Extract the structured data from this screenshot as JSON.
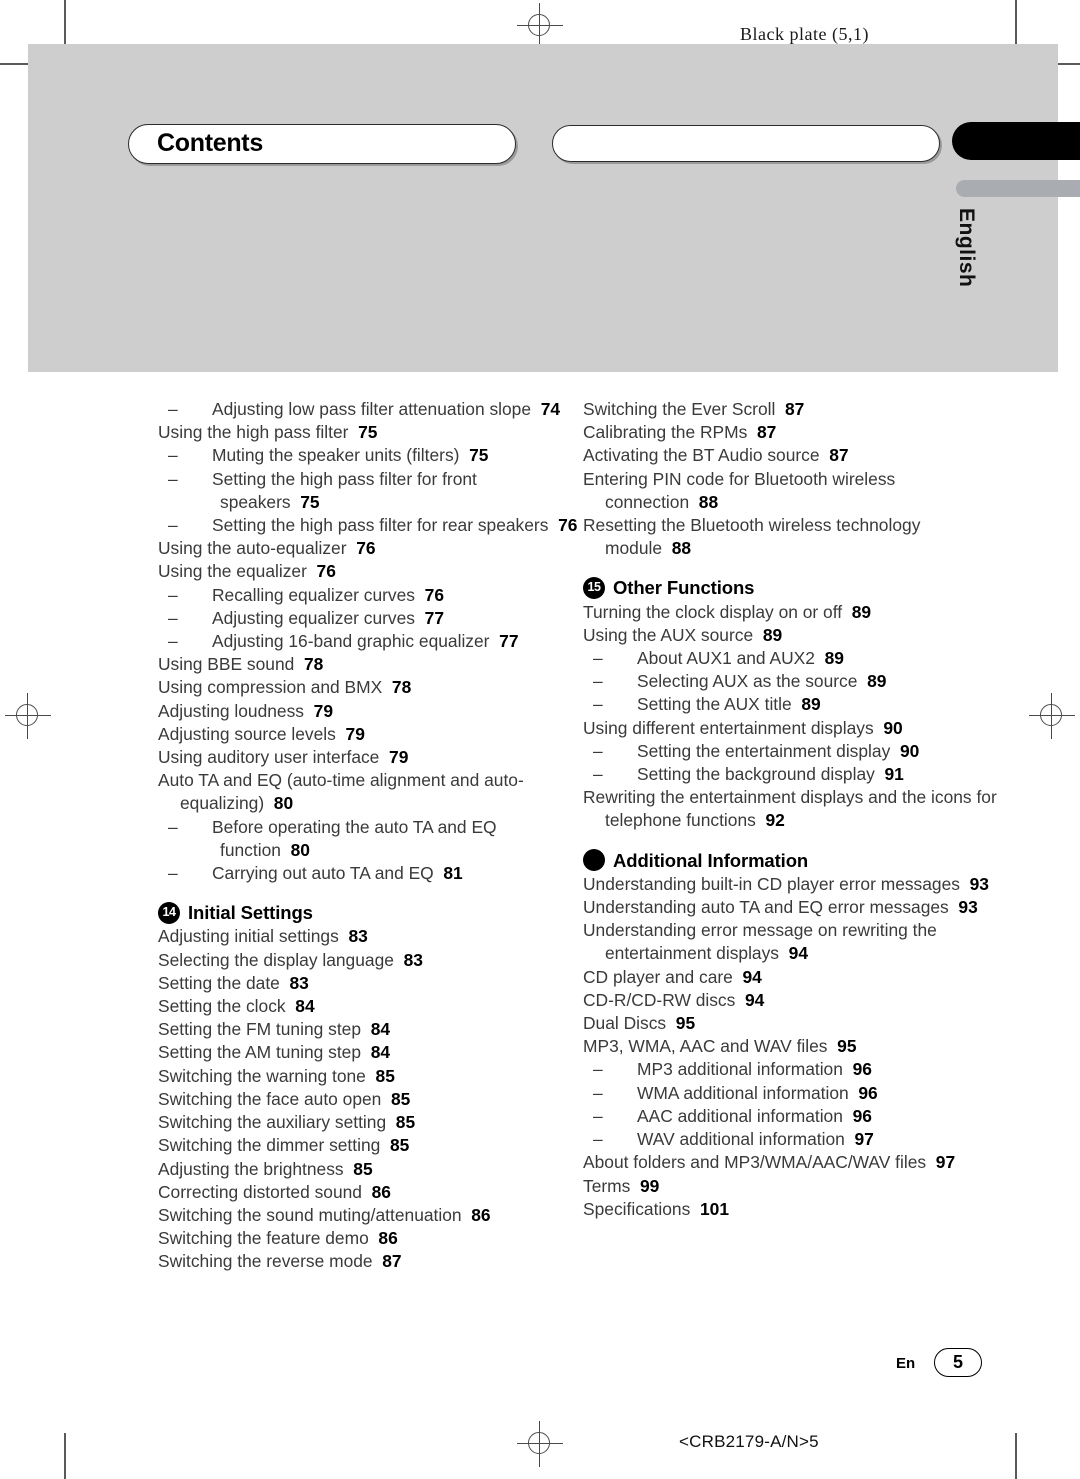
{
  "page": {
    "plate_label": "Black plate (5,1)",
    "doc_code": "<CRB2179-A/N>5",
    "footer_lang": "En",
    "page_number": "5",
    "language_tab": "English",
    "accent_black": "#000000",
    "band_gray": "#cecece",
    "tab_gray": "#a9acb0"
  },
  "header": {
    "title": "Contents",
    "second_bar": ""
  },
  "toc": {
    "left_column": [
      {
        "type": "sub",
        "text": "Adjusting low pass filter attenuation slope",
        "page": "74"
      },
      {
        "type": "entry",
        "text": "Using the high pass filter",
        "page": "75"
      },
      {
        "type": "sub",
        "text": "Muting the speaker units (filters)",
        "page": "75"
      },
      {
        "type": "sub",
        "text": "Setting the high pass filter for front speakers",
        "page": "75"
      },
      {
        "type": "sub",
        "text": "Setting the high pass filter for rear speakers",
        "page": "76"
      },
      {
        "type": "entry",
        "text": "Using the auto-equalizer",
        "page": "76"
      },
      {
        "type": "entry",
        "text": "Using the equalizer",
        "page": "76"
      },
      {
        "type": "sub",
        "text": "Recalling equalizer curves",
        "page": "76"
      },
      {
        "type": "sub",
        "text": "Adjusting equalizer curves",
        "page": "77"
      },
      {
        "type": "sub",
        "text": "Adjusting 16-band graphic equalizer",
        "page": "77"
      },
      {
        "type": "entry",
        "text": "Using BBE sound",
        "page": "78"
      },
      {
        "type": "entry",
        "text": "Using compression and BMX",
        "page": "78"
      },
      {
        "type": "entry",
        "text": "Adjusting loudness",
        "page": "79"
      },
      {
        "type": "entry",
        "text": "Adjusting source levels",
        "page": "79"
      },
      {
        "type": "entry",
        "text": "Using auditory user interface",
        "page": "79"
      },
      {
        "type": "entry",
        "text": "Auto TA and EQ (auto-time alignment and auto-equalizing)",
        "page": "80"
      },
      {
        "type": "sub",
        "text": "Before operating the auto TA and EQ function",
        "page": "80"
      },
      {
        "type": "sub",
        "text": "Carrying out auto TA and EQ",
        "page": "81"
      },
      {
        "type": "section",
        "badge": "14",
        "text": "Initial Settings"
      },
      {
        "type": "entry",
        "text": "Adjusting initial settings",
        "page": "83"
      },
      {
        "type": "entry",
        "text": "Selecting the display language",
        "page": "83"
      },
      {
        "type": "entry",
        "text": "Setting the date",
        "page": "83"
      },
      {
        "type": "entry",
        "text": "Setting the clock",
        "page": "84"
      },
      {
        "type": "entry",
        "text": "Setting the FM tuning step",
        "page": "84"
      },
      {
        "type": "entry",
        "text": "Setting the AM tuning step",
        "page": "84"
      },
      {
        "type": "entry",
        "text": "Switching the warning tone",
        "page": "85"
      },
      {
        "type": "entry",
        "text": "Switching the face auto open",
        "page": "85"
      },
      {
        "type": "entry",
        "text": "Switching the auxiliary setting",
        "page": "85"
      },
      {
        "type": "entry",
        "text": "Switching the dimmer setting",
        "page": "85"
      },
      {
        "type": "entry",
        "text": "Adjusting the brightness",
        "page": "85"
      },
      {
        "type": "entry",
        "text": "Correcting distorted sound",
        "page": "86"
      },
      {
        "type": "entry",
        "text": "Switching the sound muting/attenuation",
        "page": "86"
      },
      {
        "type": "entry",
        "text": "Switching the feature demo",
        "page": "86"
      },
      {
        "type": "entry",
        "text": "Switching the reverse mode",
        "page": "87"
      }
    ],
    "right_column": [
      {
        "type": "entry",
        "text": "Switching the Ever Scroll",
        "page": "87"
      },
      {
        "type": "entry",
        "text": "Calibrating the RPMs",
        "page": "87"
      },
      {
        "type": "entry",
        "text": "Activating the BT Audio source",
        "page": "87"
      },
      {
        "type": "entry",
        "text": "Entering PIN code for Bluetooth wireless connection",
        "page": "88"
      },
      {
        "type": "entry",
        "text": "Resetting the Bluetooth wireless technology module",
        "page": "88"
      },
      {
        "type": "section",
        "badge": "15",
        "text": "Other Functions"
      },
      {
        "type": "entry",
        "text": "Turning the clock display on or off",
        "page": "89"
      },
      {
        "type": "entry",
        "text": "Using the AUX source",
        "page": "89"
      },
      {
        "type": "sub",
        "text": "About AUX1 and AUX2",
        "page": "89"
      },
      {
        "type": "sub",
        "text": "Selecting AUX as the source",
        "page": "89"
      },
      {
        "type": "sub",
        "text": "Setting the AUX title",
        "page": "89"
      },
      {
        "type": "entry",
        "text": "Using different entertainment displays",
        "page": "90"
      },
      {
        "type": "sub",
        "text": "Setting the entertainment display",
        "page": "90"
      },
      {
        "type": "sub",
        "text": "Setting the background display",
        "page": "91"
      },
      {
        "type": "entry",
        "text": "Rewriting the entertainment displays and the icons for telephone functions",
        "page": "92"
      },
      {
        "type": "section",
        "badge": "",
        "text": "Additional Information"
      },
      {
        "type": "entry",
        "text": "Understanding built-in CD player error messages",
        "page": "93"
      },
      {
        "type": "entry",
        "text": "Understanding auto TA and EQ error messages",
        "page": "93"
      },
      {
        "type": "entry",
        "text": "Understanding error message on rewriting the entertainment displays",
        "page": "94"
      },
      {
        "type": "entry",
        "text": "CD player and care",
        "page": "94"
      },
      {
        "type": "entry",
        "text": "CD-R/CD-RW discs",
        "page": "94"
      },
      {
        "type": "entry",
        "text": "Dual Discs",
        "page": "95"
      },
      {
        "type": "entry",
        "text": "MP3, WMA, AAC and WAV files",
        "page": "95"
      },
      {
        "type": "sub",
        "text": "MP3 additional information",
        "page": "96"
      },
      {
        "type": "sub",
        "text": "WMA additional information",
        "page": "96"
      },
      {
        "type": "sub",
        "text": "AAC additional information",
        "page": "96"
      },
      {
        "type": "sub",
        "text": "WAV additional information",
        "page": "97"
      },
      {
        "type": "entry",
        "text": "About folders and MP3/WMA/AAC/WAV files",
        "page": "97"
      },
      {
        "type": "entry",
        "text": "Terms",
        "page": "99"
      },
      {
        "type": "entry",
        "text": "Specifications",
        "page": "101"
      }
    ]
  }
}
